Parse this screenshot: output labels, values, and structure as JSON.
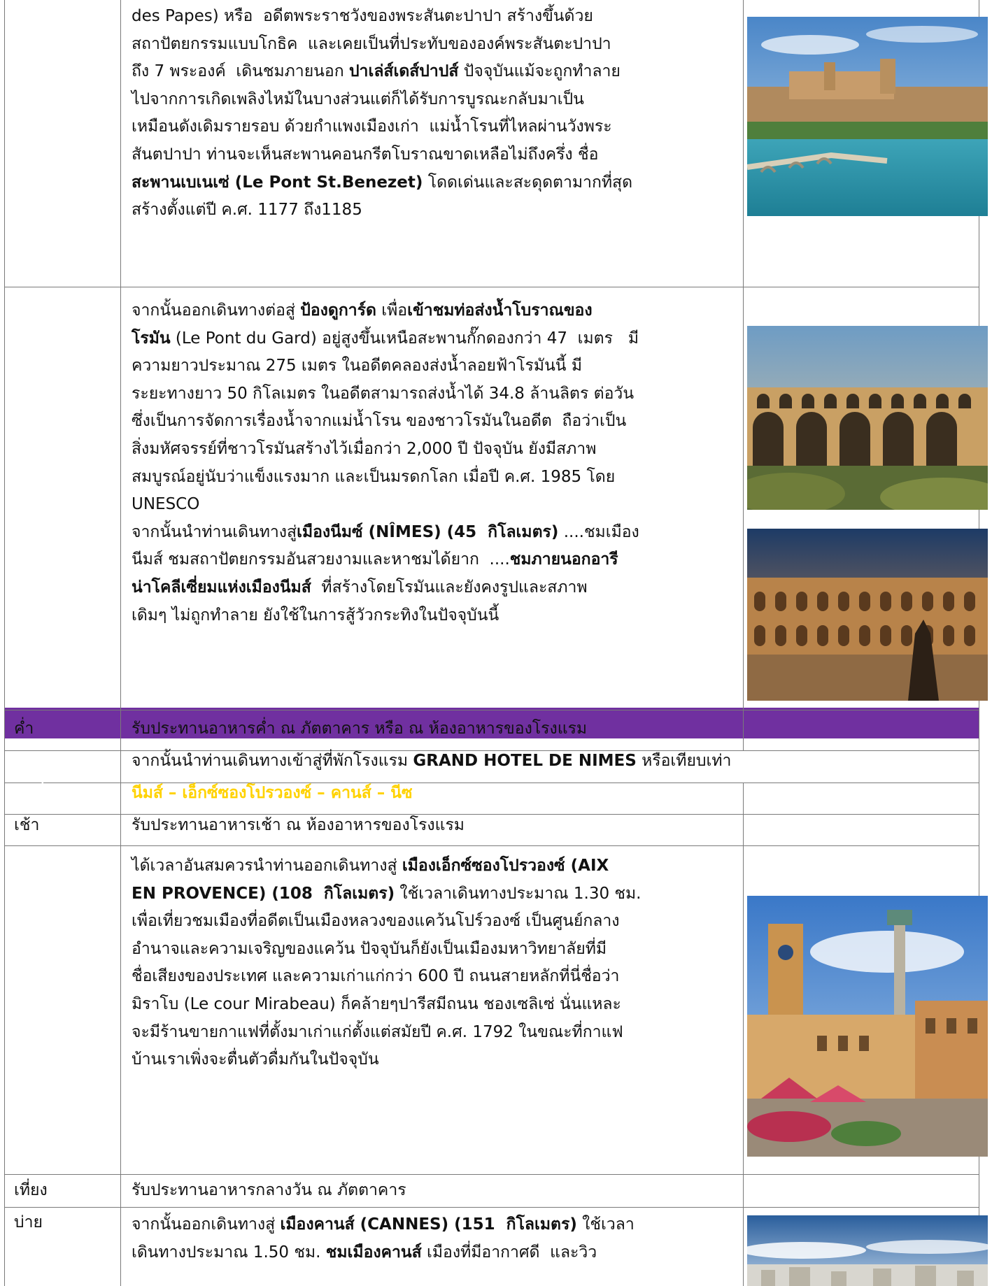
{
  "colors": {
    "header_band": "#7030a0",
    "header_day_text": "#ffffff",
    "header_route_text": "#ffd200",
    "grid_lines": "#7a7a7a"
  },
  "rows": [
    {
      "label": "",
      "lines": [
        [
          {
            "t": "des Papes) หรือ  อดีตพระราชวังของพระสันตะปาปา สร้างขึ้นด้วย"
          }
        ],
        [
          {
            "t": "สถาปัตยกรรมแบบโกธิค  และเคยเป็นที่ประทับขององค์พระสันตะปาปา"
          }
        ],
        [
          {
            "t": "ถึง 7 พระองค์  เดินชมภายนอก "
          },
          {
            "t": "ปาเล่ส์เดส์ปาปส์",
            "b": true
          },
          {
            "t": " ปัจจุบันแม้จะถูกทำลาย"
          }
        ],
        [
          {
            "t": "ไปจากการเกิดเพลิงไหม้ในบางส่วนแต่ก็ได้รับการบูรณะกลับมาเป็น"
          }
        ],
        [
          {
            "t": "เหมือนดังเดิมรายรอบ ด้วยกำแพงเมืองเก่า  แม่น้ำโรนที่ไหลผ่านวังพระ"
          }
        ],
        [
          {
            "t": "สันตปาปา ท่านจะเห็นสะพานคอนกรีตโบราณขาดเหลือไม่ถึงครึ่ง ชื่อ"
          }
        ],
        [
          {
            "t": "สะพานเบเนเซ่ (Le Pont St.Benezet)",
            "b": true
          },
          {
            "t": " โดดเด่นและสะดุดตามากที่สุด"
          }
        ],
        [
          {
            "t": "สร้างตั้งแต่ปี ค.ศ. 1177 ถึง1185"
          }
        ]
      ]
    },
    {
      "label": "",
      "lines": [
        [
          {
            "t": "จากนั้นออกเดินทางต่อสู่ "
          },
          {
            "t": "ป้องดูการ์ด",
            "b": true
          },
          {
            "t": " เพื่อ"
          },
          {
            "t": "เข้าชมท่อส่งน้ำโบราณของ",
            "b": true
          }
        ],
        [
          {
            "t": "โรมัน",
            "b": true
          },
          {
            "t": " (Le Pont du Gard) อยู่สูงขึ้นเหนือสะพานกั๊กดองกว่า 47  เมตร   มี"
          }
        ],
        [
          {
            "t": "ความยาวประมาณ 275 เมตร ในอดีตคลองส่งน้ำลอยฟ้าโรมันนี้ มี"
          }
        ],
        [
          {
            "t": "ระยะทางยาว 50 กิโลเมตร ในอดีตสามารถส่งน้ำได้ 34.8 ล้านลิตร ต่อวัน"
          }
        ],
        [
          {
            "t": "ซึ่งเป็นการจัดการเรื่องน้ำจากแม่น้ำโรน ของชาวโรมันในอดีต  ถือว่าเป็น"
          }
        ],
        [
          {
            "t": "สิ่งมหัศจรรย์ที่ชาวโรมันสร้างไว้เมื่อกว่า 2,000 ปี ปัจจุบัน ยังมีสภาพ"
          }
        ],
        [
          {
            "t": "สมบูรณ์อยู่นับว่าแข็งแรงมาก และเป็นมรดกโลก เมื่อปี ค.ศ. 1985 โดย"
          }
        ],
        [
          {
            "t": "UNESCO"
          }
        ],
        [
          {
            "t": "จากนั้นนำท่านเดินทางสู่"
          },
          {
            "t": "เมืองนีมซ์ (NÎMES) (45  กิโลเมตร)",
            "b": true
          },
          {
            "t": " ....ชมเมือง"
          }
        ],
        [
          {
            "t": "นีมส์ ชมสถาปัตยกรรมอันสวยงามและหาชมได้ยาก  ...."
          },
          {
            "t": "ชมภายนอกอารี",
            "b": true
          }
        ],
        [
          {
            "t": "น่าโคลีเซี่ยมแห่งเมืองนีมส์",
            "b": true
          },
          {
            "t": "  ที่สร้างโดยโรมันและยังคงรูปและสภาพ"
          }
        ],
        [
          {
            "t": "เดิมๆ ไม่ถูกทำลาย ยังใช้ในการสู้วัวกระทิงในปัจจุบันนี้"
          }
        ]
      ]
    },
    {
      "label": "ค่ำ",
      "lines": [
        [
          {
            "t": "รับประทานอาหารค่ำ ณ ภัตตาคาร หรือ ณ ห้องอาหารของโรงแรม"
          }
        ]
      ]
    },
    {
      "label": "",
      "lines": [
        [
          {
            "t": "จากนั้นนำท่านเดินทางเข้าสู่ที่พักโรงแรม "
          },
          {
            "t": "GRAND HOTEL DE NIMES",
            "b": true
          },
          {
            "t": " หรือเทียบเท่า"
          }
        ]
      ]
    },
    {
      "label": "วันที่ 4",
      "lines": [
        [
          {
            "t": "นีมส์ – เอ็กซ์ซองโปรวองซ์ – คานส์ – นีซ",
            "b": true
          }
        ]
      ]
    },
    {
      "label": "เช้า",
      "lines": [
        [
          {
            "t": "รับประทานอาหารเช้า ณ ห้องอาหารของโรงแรม"
          }
        ]
      ]
    },
    {
      "label": "",
      "lines": [
        [
          {
            "t": "ได้เวลาอันสมควรนำท่านออกเดินทางสู่ "
          },
          {
            "t": "เมืองเอ็กซ์ซองโปรวองซ์ (AIX",
            "b": true
          }
        ],
        [
          {
            "t": "EN PROVENCE) (108  กิโลเมตร)",
            "b": true
          },
          {
            "t": " ใช้เวลาเดินทางประมาณ 1.30 ชม."
          }
        ],
        [
          {
            "t": "เพื่อเที่ยวชมเมืองที่อดีตเป็นเมืองหลวงของแคว้นโปร์วองซ์ เป็นศูนย์กลาง"
          }
        ],
        [
          {
            "t": "อำนาจและความเจริญของแคว้น ปัจจุบันก็ยังเป็นเมืองมหาวิทยาลัยที่มี"
          }
        ],
        [
          {
            "t": "ชื่อเสียงของประเทศ และความเก่าแก่กว่า 600 ปี ถนนสายหลักที่นี่ชื่อว่า"
          }
        ],
        [
          {
            "t": "มิราโบ (Le cour Mirabeau) ก็คล้ายๆปารีสมีถนน ชองเซลิเซ่ นั่นแหละ"
          }
        ],
        [
          {
            "t": "จะมีร้านขายกาแฟที่ตั้งมาเก่าแก่ตั้งแต่สมัยปี ค.ศ. 1792 ในขณะที่กาแฟ"
          }
        ],
        [
          {
            "t": "บ้านเราเพิ่งจะตื่นตัวดื่มกันในปัจจุบัน"
          }
        ]
      ]
    },
    {
      "label": "เที่ยง",
      "lines": [
        [
          {
            "t": "รับประทานอาหารกลางวัน ณ ภัตตาคาร"
          }
        ]
      ]
    },
    {
      "label": "บ่าย",
      "lines": [
        [
          {
            "t": "จากนั้นออกเดินทางสู่ "
          },
          {
            "t": "เมืองคานส์ (CANNES) (151  กิโลเมตร)",
            "b": true
          },
          {
            "t": " ใช้เวลา"
          }
        ],
        [
          {
            "t": "เดินทางประมาณ 1.50 ชม. "
          },
          {
            "t": "ชมเมืองคานส์",
            "b": true
          },
          {
            "t": " เมืองที่มีอากาศดี  และวิว"
          }
        ]
      ]
    }
  ],
  "photos": [
    {
      "icon": "avignon-papal-palace-photo"
    },
    {
      "icon": "pont-du-gard-aqueduct-photo"
    },
    {
      "icon": "nimes-arena-photo"
    },
    {
      "icon": "aix-en-provence-square-photo"
    },
    {
      "icon": "cannes-coast-photo"
    }
  ]
}
